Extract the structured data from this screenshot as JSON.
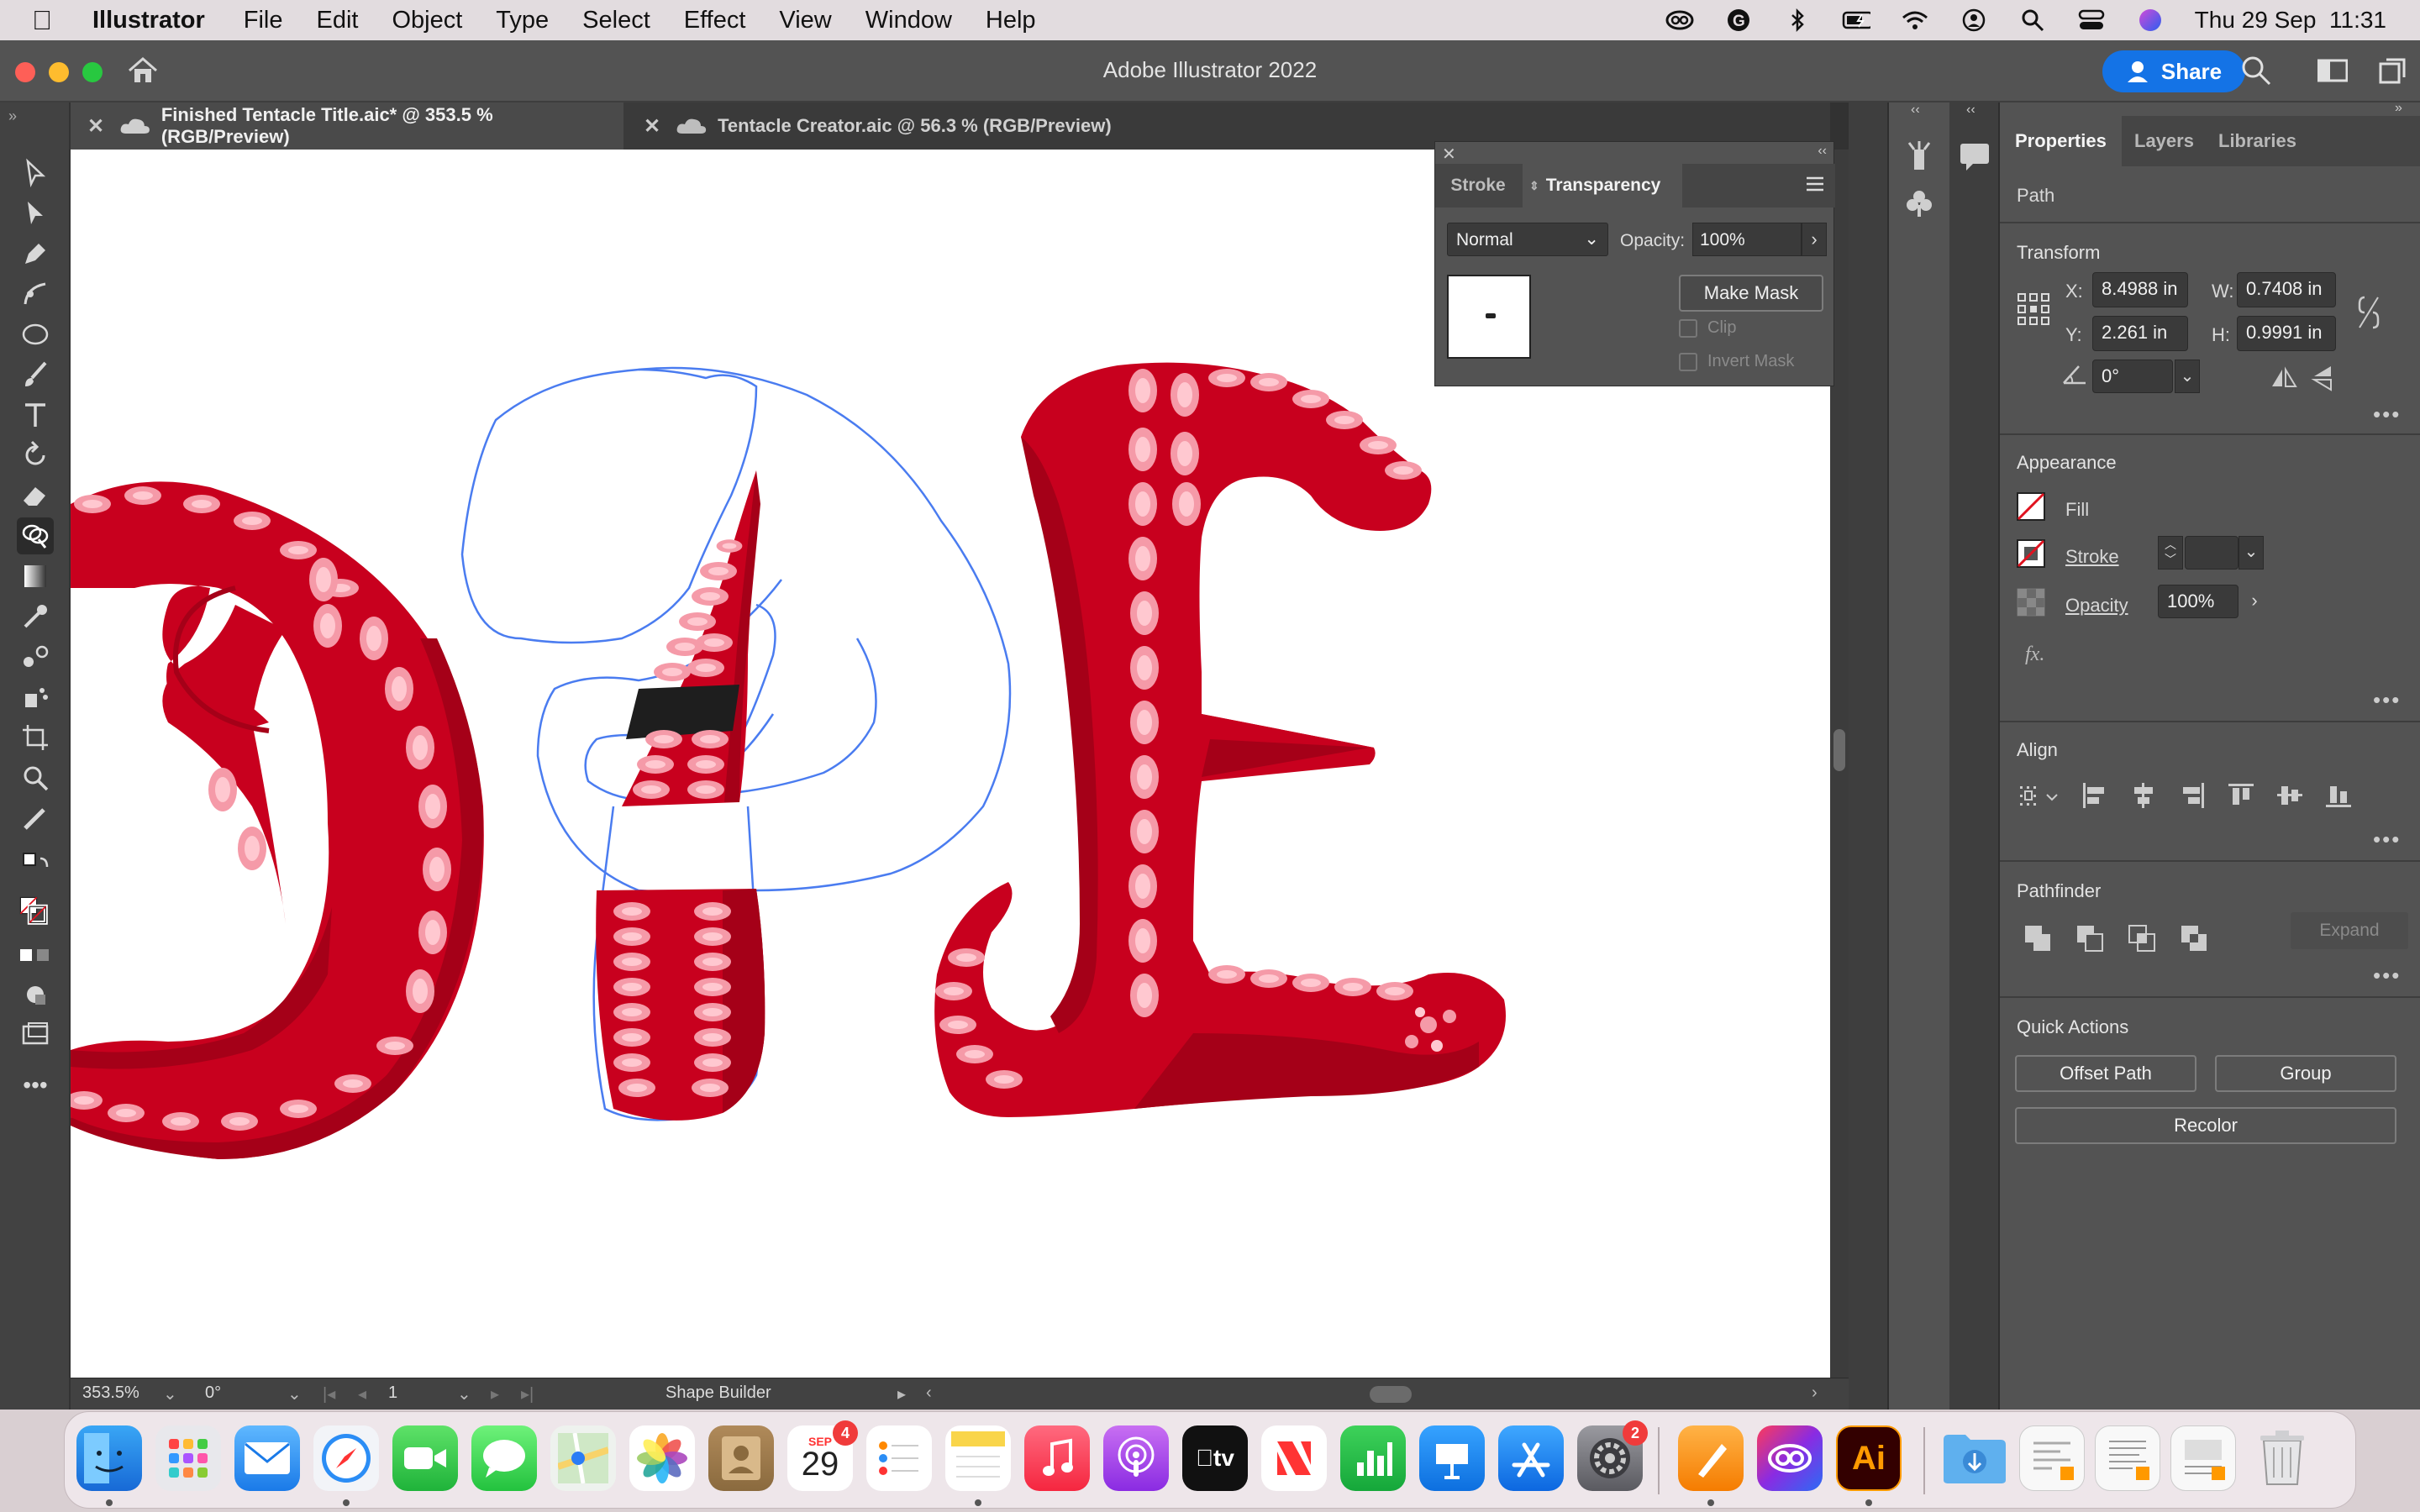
{
  "menubar": {
    "app_name": "Illustrator",
    "items": [
      "File",
      "Edit",
      "Object",
      "Type",
      "Select",
      "Effect",
      "View",
      "Window",
      "Help"
    ],
    "clock": "Thu 29 Sep  11:31"
  },
  "window": {
    "title": "Adobe Illustrator 2022",
    "share_label": "Share"
  },
  "doc_tabs": [
    {
      "label": "Finished Tentacle Title.aic* @ 353.5 % (RGB/Preview)",
      "active": true
    },
    {
      "label": "Tentacle Creator.aic @ 56.3 % (RGB/Preview)",
      "active": false
    }
  ],
  "transparency_panel": {
    "tabs": [
      "Stroke",
      "Transparency"
    ],
    "blend_mode": "Normal",
    "opacity_label": "Opacity:",
    "opacity_value": "100%",
    "make_mask_label": "Make Mask",
    "clip_label": "Clip",
    "invert_mask_label": "Invert Mask"
  },
  "properties": {
    "tabs": [
      "Properties",
      "Layers",
      "Libraries"
    ],
    "object_type": "Path",
    "transform": {
      "title": "Transform",
      "x_label": "X:",
      "x": "8.4988 in",
      "y_label": "Y:",
      "y": "2.261 in",
      "w_label": "W:",
      "w": "0.7408 in",
      "h_label": "H:",
      "h": "0.9991 in",
      "angle": "0°"
    },
    "appearance": {
      "title": "Appearance",
      "fill_label": "Fill",
      "stroke_label": "Stroke",
      "opacity_label": "Opacity",
      "opacity_value": "100%",
      "fx_label": "fx."
    },
    "align_title": "Align",
    "pathfinder": {
      "title": "Pathfinder",
      "expand_label": "Expand"
    },
    "quick_actions": {
      "title": "Quick Actions",
      "offset_path": "Offset Path",
      "group": "Group",
      "recolor": "Recolor"
    }
  },
  "statusbar": {
    "zoom": "353.5%",
    "rotation": "0°",
    "artboard": "1",
    "tool": "Shape Builder"
  },
  "dock": {
    "calendar_month": "SEP",
    "calendar_day": "29",
    "calendar_badge": "4",
    "settings_badge": "2",
    "tv_label": "tv",
    "ai_label": "Ai"
  },
  "colors": {
    "tentacle": "#c8001e",
    "tentacle_dark": "#a50018",
    "sucker": "#f59aa8",
    "sucker_light": "#ffc8d0",
    "selection": "#4a7cf0",
    "accent": "#1473e6"
  }
}
